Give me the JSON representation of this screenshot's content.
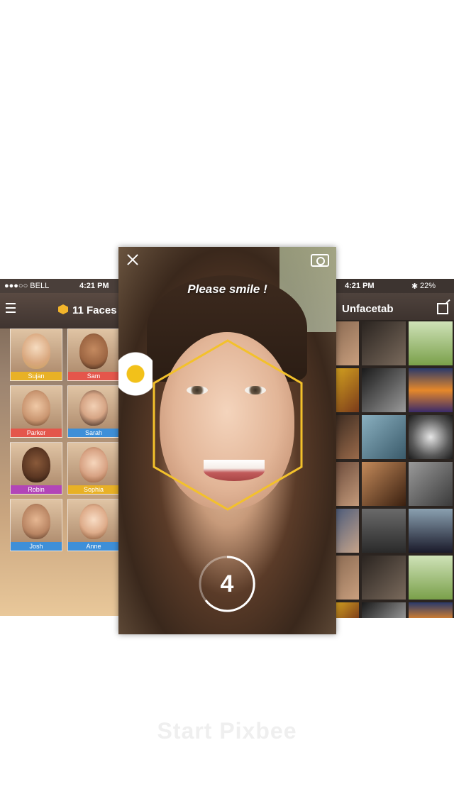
{
  "faces_screen": {
    "status": {
      "carrier": "●●●○○ BELL",
      "time": "4:21 PM"
    },
    "title": "11 Faces",
    "faces": [
      {
        "name": "Sujan",
        "color": "#e8b126"
      },
      {
        "name": "Sam",
        "color": "#e4564b"
      },
      {
        "name": "Parker",
        "color": "#e4564b"
      },
      {
        "name": "Sarah",
        "color": "#3e8fd8"
      },
      {
        "name": "Robin",
        "color": "#b245b8"
      },
      {
        "name": "Sophia",
        "color": "#e8b126"
      },
      {
        "name": "Josh",
        "color": "#3e8fd8"
      },
      {
        "name": "Anne",
        "color": "#3e8fd8"
      }
    ]
  },
  "smile_screen": {
    "prompt": "Please smile !",
    "countdown": "4",
    "accent_color": "#f3c12b"
  },
  "unfacetab_screen": {
    "status": {
      "time": "4:21 PM",
      "bluetooth": "✱",
      "battery": "22%"
    },
    "title": "Unfacetab"
  },
  "cta": {
    "label": "Start Pixbee"
  }
}
